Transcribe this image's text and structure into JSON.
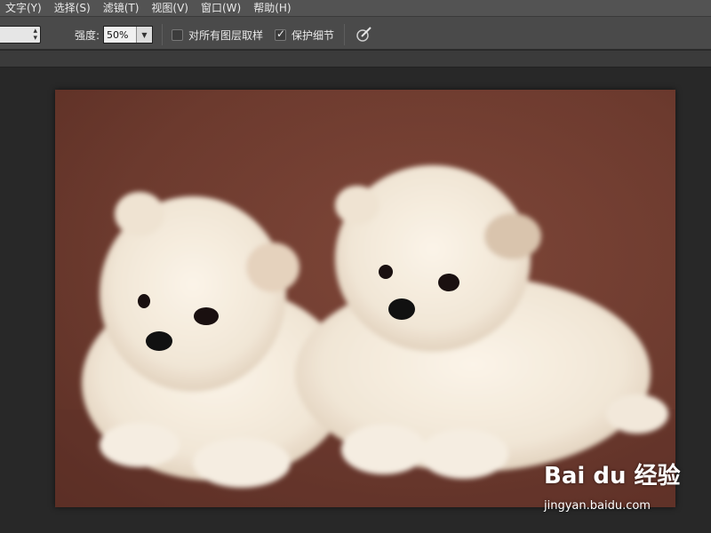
{
  "menu": {
    "items": [
      "文字(Y)",
      "选择(S)",
      "滤镜(T)",
      "视图(V)",
      "窗口(W)",
      "帮助(H)"
    ]
  },
  "options": {
    "strength_label": "强度:",
    "strength_value": "50%",
    "sample_all_layers_label": "对所有图层取样",
    "sample_all_layers_checked": false,
    "protect_detail_label": "保护细节",
    "protect_detail_checked": true
  },
  "canvas": {
    "image_subject": "two white pomeranian puppies on brown background",
    "background_color": "#6e3b2f"
  },
  "watermark": {
    "logo_text": "Bai du 经验",
    "url": "jingyan.baidu.com"
  },
  "colors": {
    "menubar": "#535353",
    "optionsbar": "#4a4a4a",
    "workspace": "#282828"
  }
}
